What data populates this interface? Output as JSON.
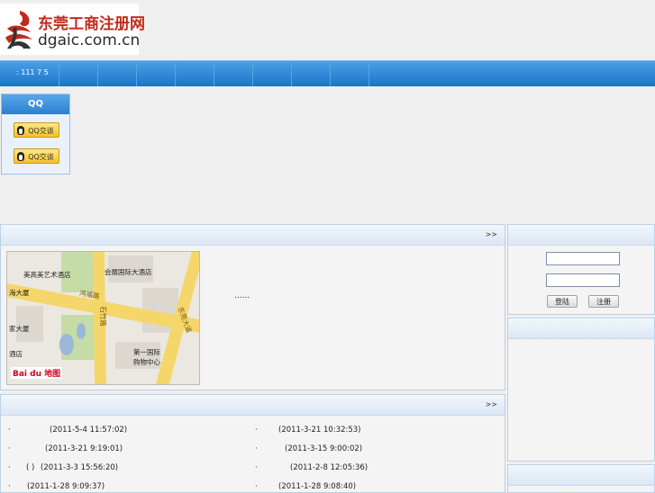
{
  "logo": {
    "cn_text": "东莞工商注册网",
    "en_text": "dgaic.com.cn"
  },
  "nav": {
    "first_item": ": 111 7 5",
    "items": [
      "",
      "",
      "",
      "",
      "",
      "",
      "",
      "",
      ""
    ]
  },
  "qq": {
    "title": "QQ",
    "buttons": [
      "QQ交谈",
      "QQ交谈"
    ]
  },
  "map_panel": {
    "more": ">>",
    "ellipsis": "......",
    "map_labels": {
      "hotel": "美高美艺术酒店",
      "center": "会展国际大酒店",
      "road1": "鸿福路",
      "road2": "石竹路",
      "road3": "东莞大道",
      "mall": "第一国际\n购物中心",
      "bldg1": "海大厦",
      "bldg2": "家大厦",
      "bldg3": "酒店",
      "baidu": "Bai du 地图"
    }
  },
  "news_panel": {
    "more": ">>",
    "bullet": "·",
    "left": [
      {
        "prefix": "",
        "date": "(2011-5-4 11:57:02)"
      },
      {
        "prefix": "",
        "date": "(2011-3-21 9:19:01)"
      },
      {
        "prefix": "(  )",
        "date": "(2011-3-3 15:56:20)"
      },
      {
        "prefix": "",
        "date": "(2011-1-28 9:09:37)"
      }
    ],
    "right": [
      {
        "prefix": "",
        "date": "(2011-3-21 10:32:53)"
      },
      {
        "prefix": "",
        "date": "(2011-3-15 9:00:02)"
      },
      {
        "prefix": "",
        "date": "(2011-2-8 12:05:36)"
      },
      {
        "prefix": "",
        "date": "(2011-1-28 9:08:40)"
      }
    ]
  },
  "login": {
    "login_button": "登陆",
    "register_button": "注册"
  },
  "colors": {
    "nav_blue": "#1c74c8",
    "panel_border": "#bcd0e6",
    "logo_red": "#c02a1c"
  }
}
